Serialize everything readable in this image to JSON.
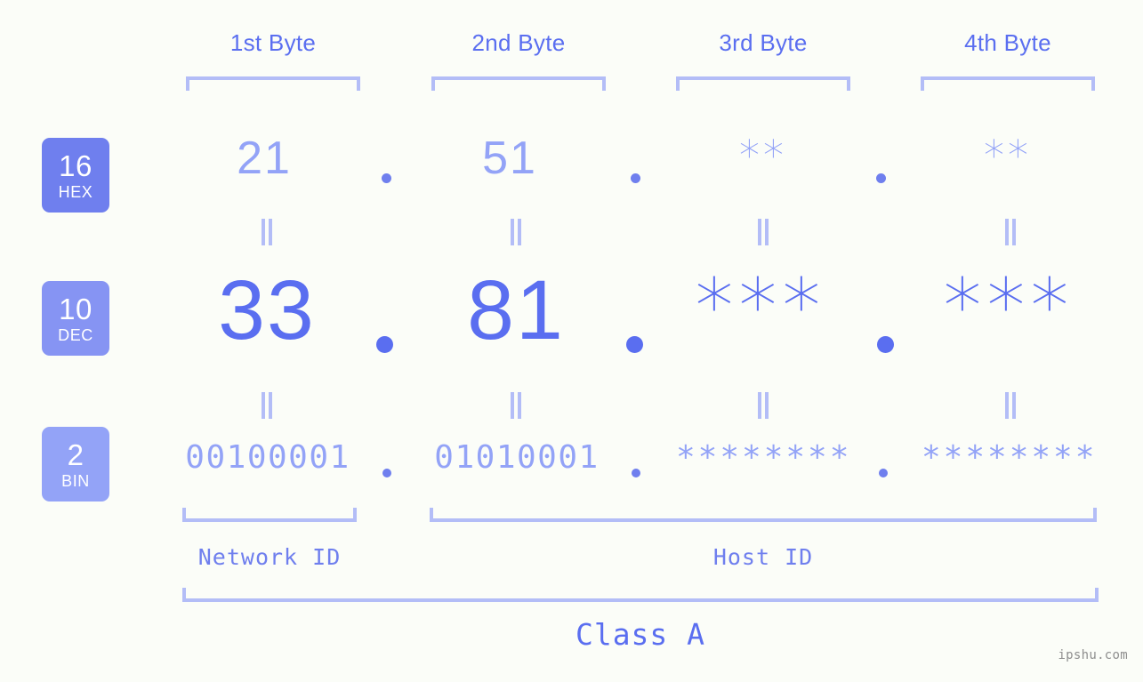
{
  "page": {
    "background_color": "#fbfdf8",
    "accent_color": "#5a6ef0",
    "accent_mid_color": "#8694f3",
    "accent_light_color": "#93a3f7",
    "bracket_color": "#b3bdf7",
    "watermark": "ipshu.com"
  },
  "headers": {
    "bytes": [
      {
        "label": "1st Byte"
      },
      {
        "label": "2nd Byte"
      },
      {
        "label": "3rd Byte"
      },
      {
        "label": "4th Byte"
      }
    ]
  },
  "bases": [
    {
      "id": "hex",
      "number": "16",
      "name": "HEX",
      "color": "#6f7fee"
    },
    {
      "id": "dec",
      "number": "10",
      "name": "DEC",
      "color": "#8694f3"
    },
    {
      "id": "bin",
      "number": "2",
      "name": "BIN",
      "color": "#93a3f7"
    }
  ],
  "rows": {
    "hex": {
      "base_number": "16",
      "base_name": "HEX",
      "values": [
        "21",
        "51",
        "**",
        "**"
      ],
      "separators": [
        ".",
        ".",
        "."
      ]
    },
    "dec": {
      "base_number": "10",
      "base_name": "DEC",
      "values": [
        "33",
        "81",
        "***",
        "***"
      ],
      "separators": [
        ".",
        ".",
        "."
      ]
    },
    "bin": {
      "base_number": "2",
      "base_name": "BIN",
      "values": [
        "00100001",
        "01010001",
        "********",
        "********"
      ],
      "separators": [
        ".",
        ".",
        "."
      ]
    }
  },
  "connectors": {
    "glyph": "=",
    "orientation": "vertical",
    "count_per_row": 4
  },
  "footer": {
    "network_id_label": "Network ID",
    "host_id_label": "Host ID",
    "class_label": "Class A"
  }
}
